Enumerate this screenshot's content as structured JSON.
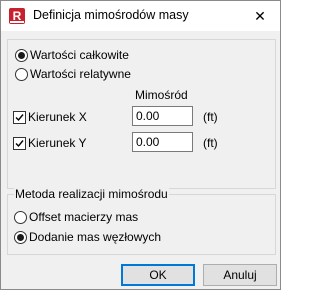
{
  "window": {
    "title": "Definicja mimośrodów masy",
    "app_icon_letter": "R",
    "close_glyph": "✕"
  },
  "value_mode": {
    "options": [
      {
        "label": "Wartości całkowite",
        "selected": true
      },
      {
        "label": "Wartości relatywne",
        "selected": false
      }
    ]
  },
  "eccentricity": {
    "column_header": "Mimośród",
    "rows": [
      {
        "label": "Kierunek X",
        "checked": true,
        "value": "0.00",
        "unit": "(ft)"
      },
      {
        "label": "Kierunek Y",
        "checked": true,
        "value": "0.00",
        "unit": "(ft)"
      }
    ]
  },
  "method": {
    "title": "Metoda realizacji mimośrodu",
    "options": [
      {
        "label": "Offset macierzy mas",
        "selected": false
      },
      {
        "label": "Dodanie mas węzłowych",
        "selected": true
      }
    ]
  },
  "buttons": {
    "ok": "OK",
    "cancel": "Anuluj"
  }
}
